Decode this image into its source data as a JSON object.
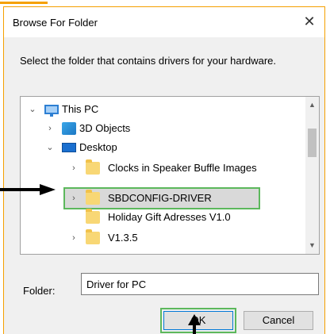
{
  "window": {
    "title": "Browse For Folder",
    "close_symbol": "✕"
  },
  "instruction": "Select the folder that contains drivers for your hardware.",
  "tree": {
    "items": [
      {
        "label": "This PC",
        "icon": "computer-icon",
        "expanded": true
      },
      {
        "label": "3D Objects",
        "icon": "3d-objects-icon",
        "expanded": false
      },
      {
        "label": "Desktop",
        "icon": "desktop-icon",
        "expanded": true
      },
      {
        "label": "Clocks in Speaker Buffle Images",
        "icon": "folder-icon",
        "expanded": false
      },
      {
        "label": "SBDCONFIG-DRIVER",
        "icon": "folder-icon",
        "expanded": false,
        "selected": true
      },
      {
        "label": "Holiday Gift Adresses V1.0",
        "icon": "folder-icon",
        "expanded": false
      },
      {
        "label": "V1.3.5",
        "icon": "folder-icon",
        "expanded": false
      }
    ]
  },
  "folder": {
    "label": "Folder:",
    "value": "Driver for PC"
  },
  "buttons": {
    "ok": "OK",
    "cancel": "Cancel"
  },
  "colors": {
    "highlight_box": "#5cb85c",
    "arrow": "#000000",
    "window_border": "#f5a000"
  }
}
